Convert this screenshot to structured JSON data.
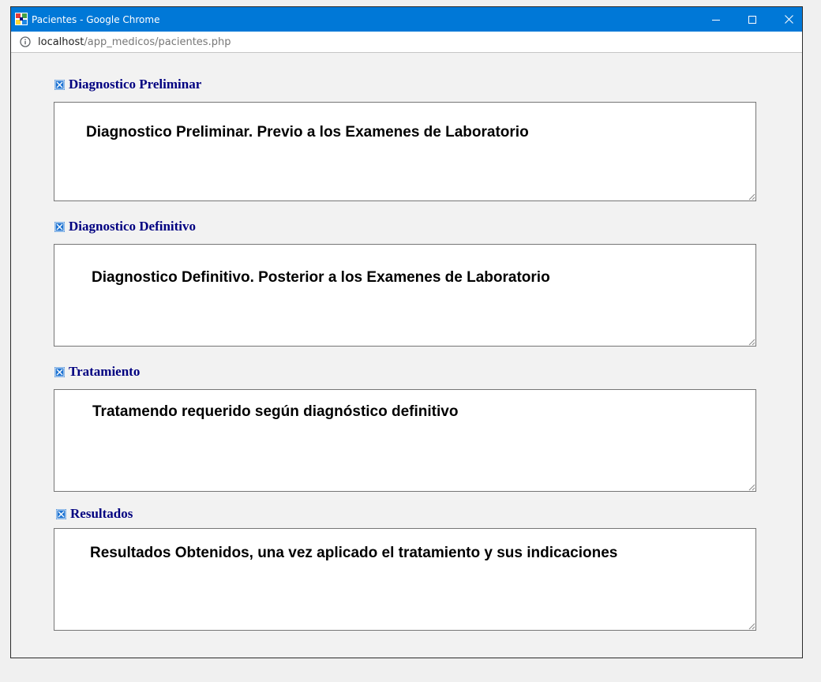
{
  "window": {
    "title": "Pacientes - Google Chrome",
    "icons": {
      "app": "app-favicon-icon",
      "minimize": "minimize-icon",
      "maximize": "maximize-icon",
      "close": "close-icon"
    }
  },
  "address_bar": {
    "icon": "info-icon",
    "url_host": "localhost",
    "url_path": "/app_medicos/pacientes.php"
  },
  "sections": [
    {
      "label": "Diagnostico Preliminar",
      "value": "Diagnostico Preliminar. Previo a los Examenes de Laboratorio"
    },
    {
      "label": "Diagnostico Definitivo",
      "value": "Diagnostico Definitivo. Posterior a los Examenes de Laboratorio"
    },
    {
      "label": "Tratamiento",
      "value": "Tratamendo requerido según diagnóstico definitivo"
    },
    {
      "label": "Resultados",
      "value": "Resultados Obtenidos, una vez aplicado el tratamiento y sus indicaciones"
    }
  ],
  "colors": {
    "titlebar": "#0078d7",
    "label_text": "#000080",
    "checkbox_icon": "#1e73d2",
    "page_background": "#f2f2f2"
  }
}
